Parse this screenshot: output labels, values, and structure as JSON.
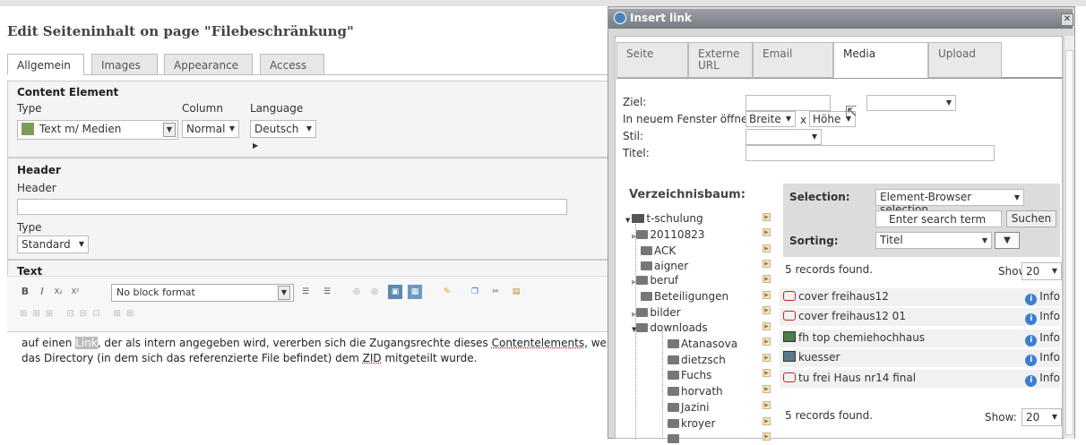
{
  "editor": {
    "title": "Edit Seiteninhalt on page \"Filebeschränkung\"",
    "tabs": [
      "Allgemein",
      "Images",
      "Appearance",
      "Access"
    ],
    "content_element": {
      "heading": "Content Element",
      "type_label": "Type",
      "type_value": "Text m/ Medien",
      "column_label": "Column",
      "column_value": "Normal",
      "language_label": "Language",
      "language_value": "Deutsch"
    },
    "header_section": {
      "heading": "Header",
      "header_label": "Header",
      "type_label": "Type",
      "type_value": "Standard"
    },
    "text_section": {
      "heading": "Text",
      "block_format": "No block format",
      "body_before_link": "auf einen ",
      "link_word": "Link",
      "body_mid": ", der als intern angegeben wird, vererben sich die Zugangsrechte dieses ",
      "body_word2": "Contentelements",
      "body_mid2": ", wenn",
      "body_line2a": "das Directory (in dem sich das referenzierte File befindet) dem ",
      "body_word3": "ZID",
      "body_line2b": " mitgeteilt wurde."
    }
  },
  "dialog": {
    "title": "Insert link",
    "tabs": [
      "Seite",
      "Externe URL",
      "Email",
      "Media",
      "Upload"
    ],
    "active_tab": "Media",
    "fields": {
      "ziel": "Ziel:",
      "new_window": "In neuem Fenster öffnen:",
      "breite": "Breite",
      "x": "x",
      "hoehe": "Höhe",
      "stil": "Stil:",
      "titel": "Titel:"
    },
    "tree": {
      "heading": "Verzeichnisbaum:",
      "root": "t-schulung",
      "items": [
        "20110823",
        "ACK",
        "aigner",
        "beruf",
        "Beteiligungen",
        "bilder",
        "downloads",
        "Atanasova",
        "dietzsch",
        "Fuchs",
        "horvath",
        "Jazini",
        "kroyer"
      ]
    },
    "selection": {
      "label": "Selection:",
      "value": "Element-Browser selection",
      "search_placeholder": "Enter search term",
      "search_button": "Suchen",
      "sorting_label": "Sorting:",
      "sorting_value": "Titel"
    },
    "records": {
      "found_text": "5 records found.",
      "show_label": "Show:",
      "show_value": "20",
      "files": [
        {
          "name": "cover freihaus12",
          "kind": "pdf"
        },
        {
          "name": "cover freihaus12 01",
          "kind": "pdf"
        },
        {
          "name": "fh top chemiehochhaus",
          "kind": "img"
        },
        {
          "name": "kuesser",
          "kind": "img"
        },
        {
          "name": "tu frei Haus nr14 final",
          "kind": "pdf"
        }
      ],
      "info_label": "Info",
      "footer_found_text": "5 records found.",
      "footer_show_label": "Show:",
      "footer_show_value": "20"
    }
  }
}
